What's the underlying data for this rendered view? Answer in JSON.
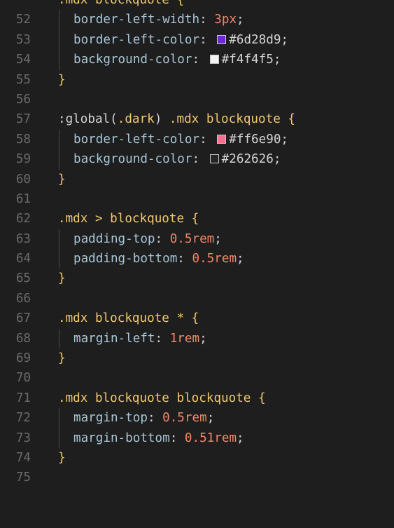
{
  "colors": {
    "background": "#1e1e1e",
    "line_number": "#6b6b6b",
    "selector": "#f0c86f",
    "property": "#a8c6d6",
    "number": "#f2866b",
    "text": "#d4d4d4"
  },
  "lines": [
    {
      "num": "52",
      "sel": ".mdx blockquote",
      "brace": "{"
    },
    {
      "num": "53",
      "prop": "border-left-width",
      "num_val": "3px"
    },
    {
      "num": "54",
      "prop": "border-left-color",
      "swatch": "#6d28d9",
      "hex": "#6d28d9"
    },
    {
      "num": "55",
      "prop": "background-color",
      "swatch": "#f4f4f5",
      "hex": "#f4f4f5"
    },
    {
      "num": "56",
      "close": "}"
    },
    {
      "num": "57"
    },
    {
      "num": "58",
      "sel_pre": ":global(",
      "sel_mid": ".dark",
      "sel_post": ") ",
      "sel_tail": ".mdx blockquote",
      "brace": "{"
    },
    {
      "num": "59",
      "prop": "border-left-color",
      "swatch": "#ff6e90",
      "hex": "#ff6e90"
    },
    {
      "num": "60",
      "prop": "background-color",
      "swatch": "#262626",
      "hex": "#262626"
    },
    {
      "num": "61",
      "close": "}"
    },
    {
      "num": "62"
    },
    {
      "num": "63",
      "sel": ".mdx > blockquote",
      "brace": "{"
    },
    {
      "num": "64",
      "prop": "padding-top",
      "num_val": "0.5rem"
    },
    {
      "num": "65",
      "prop": "padding-bottom",
      "num_val": "0.5rem"
    },
    {
      "num": "66",
      "close": "}"
    },
    {
      "num": "67"
    },
    {
      "num": "68",
      "sel": ".mdx blockquote *",
      "brace": "{"
    },
    {
      "num": "69",
      "prop": "margin-left",
      "num_val": "1rem"
    },
    {
      "num": "70",
      "close": "}"
    },
    {
      "num": "71"
    },
    {
      "num": "72",
      "sel": ".mdx blockquote blockquote",
      "brace": "{"
    },
    {
      "num": "73",
      "prop": "margin-top",
      "num_val": "0.5rem"
    },
    {
      "num": "74",
      "prop": "margin-bottom",
      "num_val": "0.51rem"
    },
    {
      "num": "75",
      "close": "}"
    }
  ]
}
